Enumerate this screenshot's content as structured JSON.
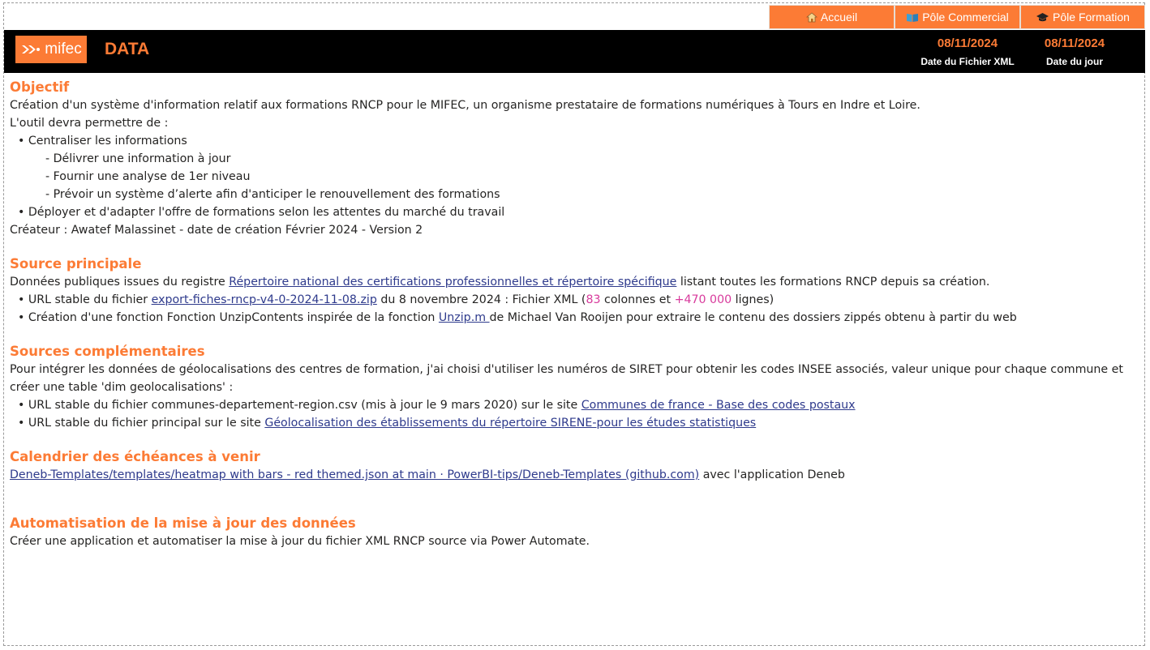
{
  "nav": {
    "home_label": "Accueil",
    "commercial_label": "Pôle Commercial",
    "formation_label": "Pôle Formation",
    "color": "#fc7b35"
  },
  "header": {
    "logo_text": "mifec",
    "title": "DATA",
    "file_date": "08/11/2024",
    "file_date_label": "Date du Fichier XML",
    "today_date": "08/11/2024",
    "today_date_label": "Date du jour"
  },
  "objectif": {
    "heading": "Objectif",
    "intro": "Création d'un système d'information relatif aux formations RNCP pour le MIFEC, un organisme prestataire de formations numériques à Tours en Indre et Loire.",
    "lead": "L'outil devra permettre de :",
    "bullet1": "• Centraliser les informations",
    "sub1": "- Délivrer une information à jour",
    "sub2": "- Fournir une analyse de 1er niveau",
    "sub3": "- Prévoir un système d’alerte afin d'anticiper le renouvellement des formations",
    "bullet2": "• Déployer et d'adapter l'offre de formations selon les attentes du marché du travail",
    "creator": "Créateur : Awatef Malassinet - date de création Février 2024 - Version 2"
  },
  "source": {
    "heading": "Source principale",
    "line1_pre": "Données publiques issues du registre ",
    "line1_link": "Répertoire national des certifications professionnelles et répertoire spécifique",
    "line1_post": " listant toutes les formations RNCP depuis sa création.",
    "line2_pre": "•  URL stable du fichier  ",
    "line2_link": "export-fiches-rncp-v4-0-2024-11-08.zip",
    "line2_mid": "  du 8 novembre 2024 : Fichier XML (",
    "line2_cols": "83",
    "line2_mid2": " colonnes et ",
    "line2_rows": "+470 000",
    "line2_post": " lignes)",
    "line3_pre": "• Création d'une fonction Fonction UnzipContents inspirée de la fonction ",
    "line3_link": "Unzip.m ",
    "line3_post": " de Michael Van Rooijen pour extraire le contenu des dossiers zippés obtenu à partir du web"
  },
  "complementaires": {
    "heading": "Sources complémentaires",
    "intro": "Pour intégrer les données de géolocalisations des centres de formation, j'ai choisi d'utiliser les numéros de SIRET pour obtenir les codes INSEE associés, valeur unique pour chaque commune et créer  une table 'dim geolocalisations' :",
    "line1_pre": "• URL stable du fichier communes-departement-region.csv  (mis à jour le 9 mars 2020) sur le site ",
    "line1_link": "Communes de france - Base des codes postaux ",
    "line2_pre": "• URL stable  du fichier principal sur le site ",
    "line2_link": "Géolocalisation des établissements du répertoire SIRENE-pour les études statistiques"
  },
  "calendrier": {
    "heading": "Calendrier des échéances à venir",
    "link": "Deneb-Templates/templates/heatmap with bars - red themed.json at main · PowerBI-tips/Deneb-Templates (github.com)",
    "post": "  avec l'application Deneb"
  },
  "automatisation": {
    "heading": "Automatisation de la mise à jour des données",
    "text": "Créer une application et automatiser la mise à jour du fichier XML RNCP source via Power Automate."
  }
}
